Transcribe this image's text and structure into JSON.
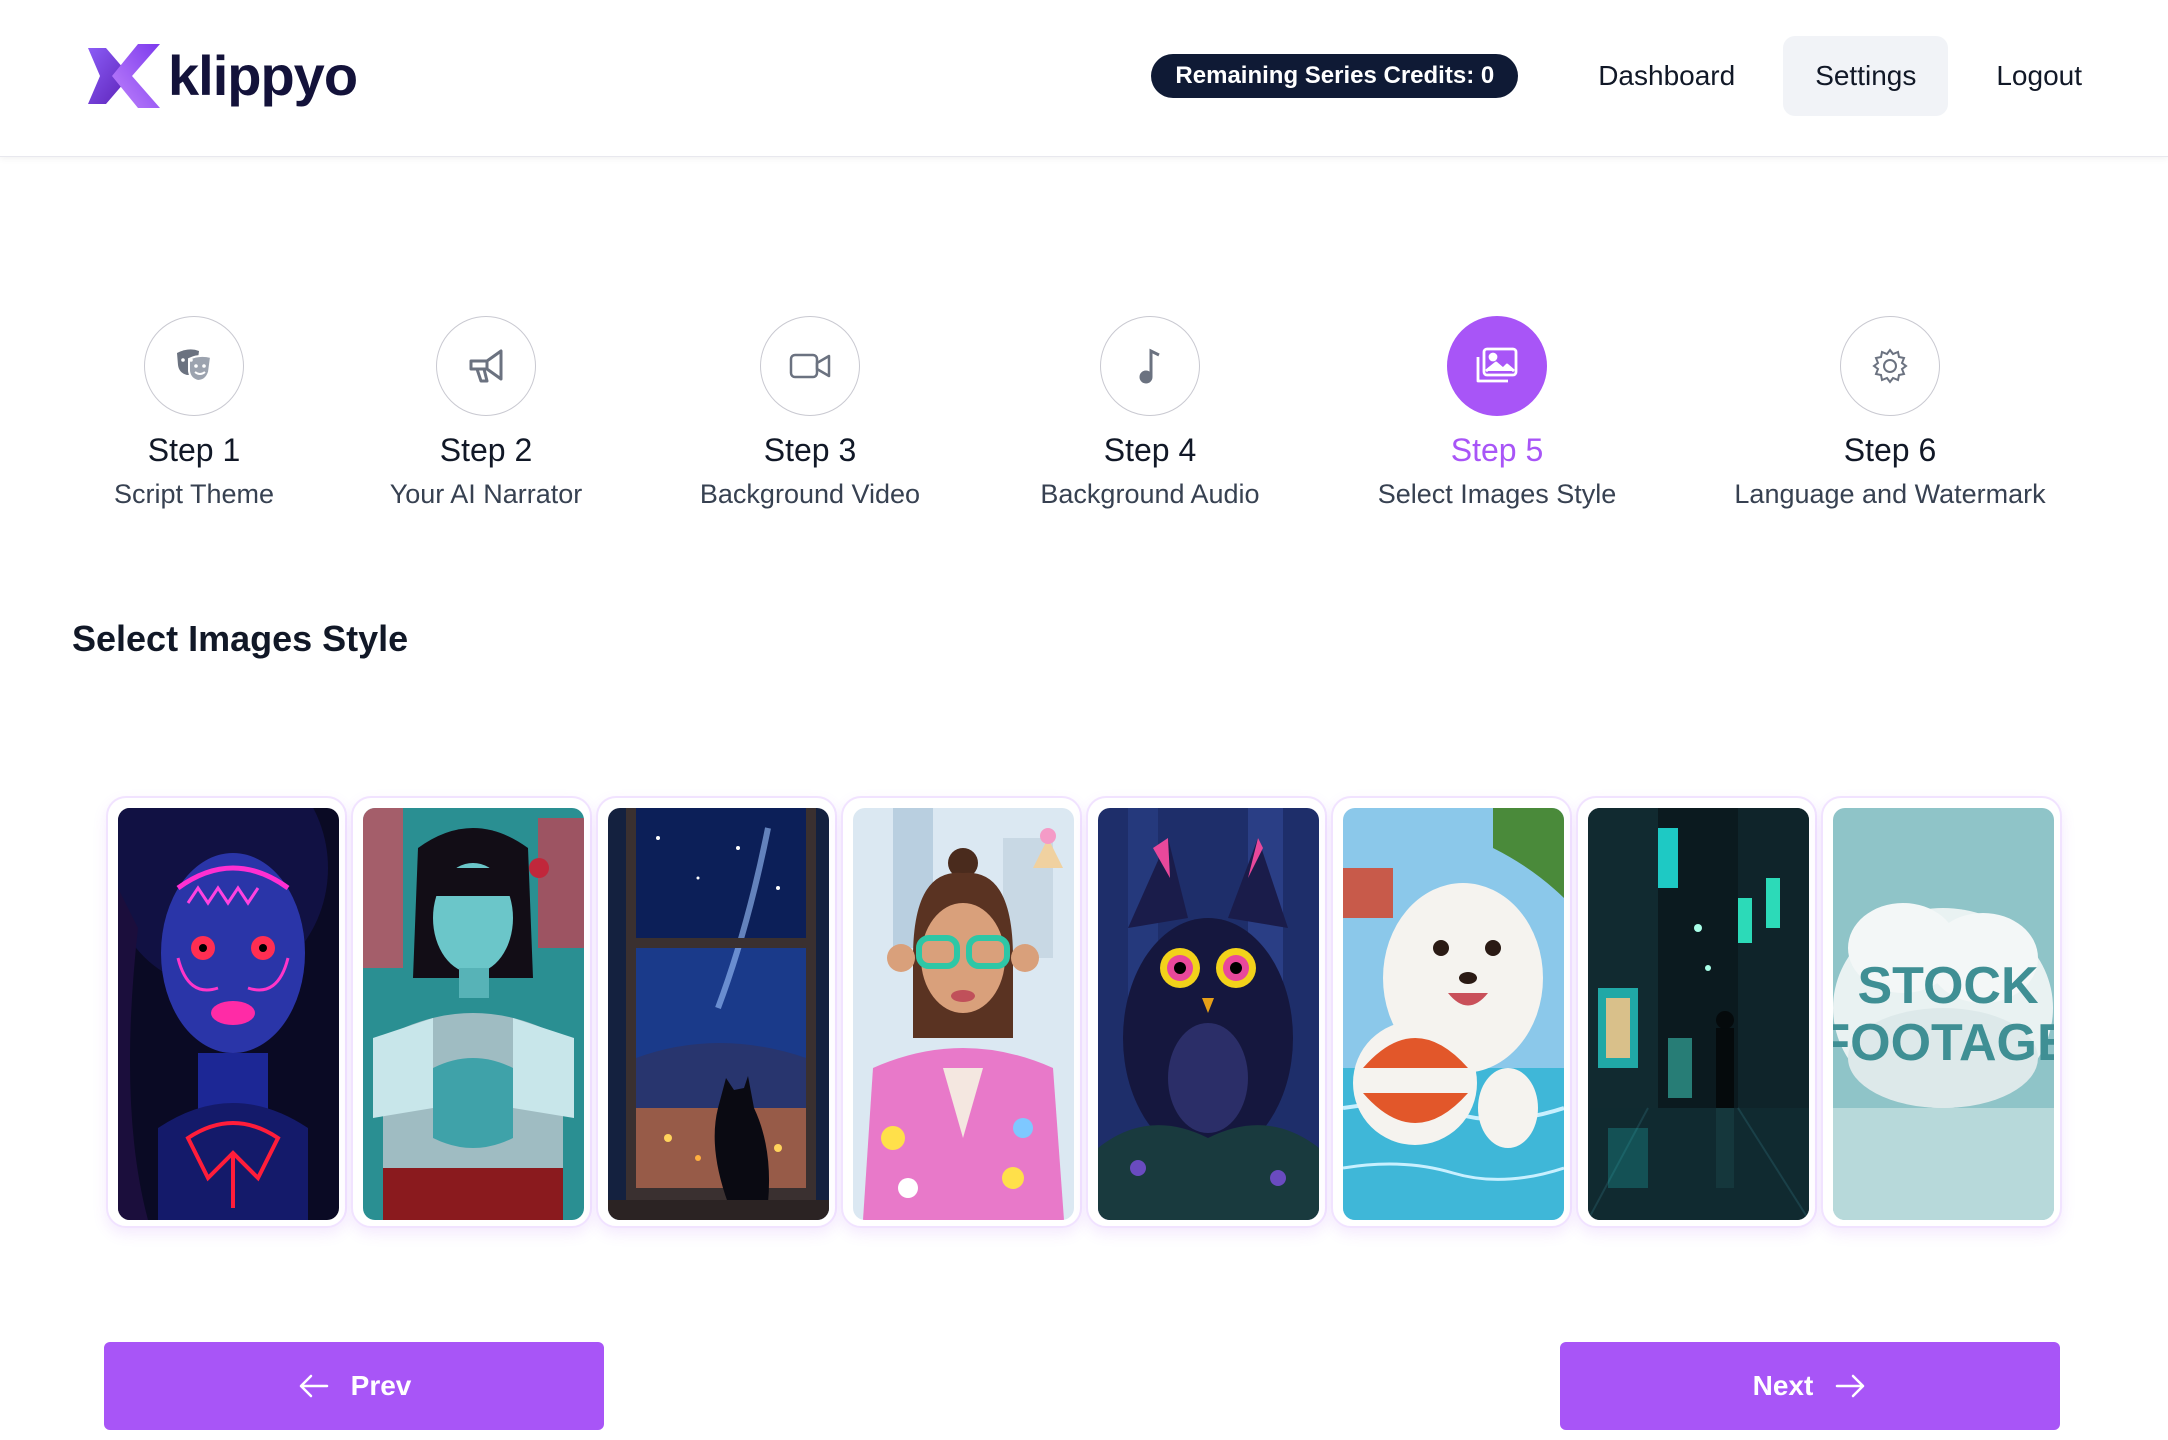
{
  "app": {
    "name": "klippyo"
  },
  "header": {
    "credits_label": "Remaining Series Credits: 0",
    "nav": [
      {
        "label": "Dashboard",
        "icon": "none"
      },
      {
        "label": "Settings",
        "active": true
      },
      {
        "label": "Logout"
      }
    ]
  },
  "steps": [
    {
      "num": "Step 1",
      "label": "Script Theme",
      "icon": "theater-masks-icon"
    },
    {
      "num": "Step 2",
      "label": "Your AI Narrator",
      "icon": "megaphone-icon"
    },
    {
      "num": "Step 3",
      "label": "Background Video",
      "icon": "video-camera-icon"
    },
    {
      "num": "Step 4",
      "label": "Background Audio",
      "icon": "music-note-icon"
    },
    {
      "num": "Step 5",
      "label": "Select Images Style",
      "icon": "images-icon",
      "active": true
    },
    {
      "num": "Step 6",
      "label": "Language and Watermark",
      "icon": "gear-icon"
    }
  ],
  "section": {
    "title": "Select Images Style"
  },
  "styles": [
    {
      "name": "neon-face-paint",
      "image": "woman with glowing neon face paint"
    },
    {
      "name": "cyberpunk-warrior",
      "image": "woman in silver armor, teal neon"
    },
    {
      "name": "anime-night-window",
      "image": "cat at window under starry night sky"
    },
    {
      "name": "pop-art",
      "image": "girl with green glasses and sticker jacket"
    },
    {
      "name": "3d-creature",
      "image": "fluffy dark-blue owl creature with yellow eyes"
    },
    {
      "name": "cute-3d-render",
      "image": "white seal pup with beach ball in pool"
    },
    {
      "name": "cinematic-street",
      "image": "rainy neon street at night with walking figure"
    },
    {
      "name": "stock-footage",
      "image": "cloud text",
      "text_line1": "STOCK",
      "text_line2": "FOOTAGE"
    }
  ],
  "buttons": {
    "prev": "Prev",
    "next": "Next"
  },
  "colors": {
    "accent": "#a855f7",
    "credits_bg": "#0f1a35",
    "logo_purple": "#7c3aed"
  }
}
